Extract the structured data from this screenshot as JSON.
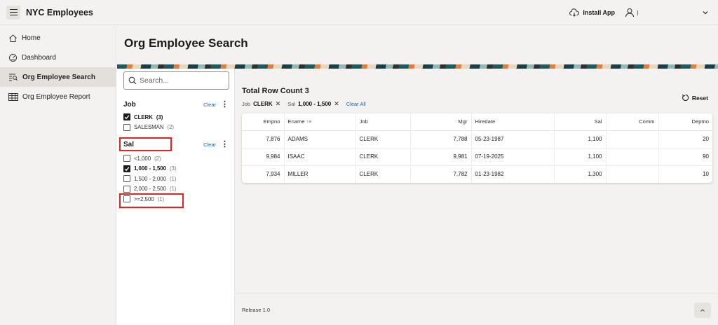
{
  "app": {
    "title": "NYC Employees"
  },
  "header": {
    "install_label": "Install App"
  },
  "sidebar": {
    "items": [
      {
        "label": "Home",
        "icon": "home-icon",
        "active": false
      },
      {
        "label": "Dashboard",
        "icon": "dashboard-icon",
        "active": false
      },
      {
        "label": "Org Employee Search",
        "icon": "search-list-icon",
        "active": true
      },
      {
        "label": "Org Employee Report",
        "icon": "table-icon",
        "active": false
      }
    ]
  },
  "page": {
    "title": "Org Employee Search"
  },
  "search": {
    "placeholder": "Search..."
  },
  "facets": {
    "job": {
      "title": "Job",
      "clear_label": "Clear",
      "options": [
        {
          "label": "CLERK",
          "count": "(3)",
          "checked": true
        },
        {
          "label": "SALESMAN",
          "count": "(2)",
          "checked": false
        }
      ]
    },
    "sal": {
      "title": "Sal",
      "clear_label": "Clear",
      "options": [
        {
          "label": "<1,000",
          "count": "(2)",
          "checked": false
        },
        {
          "label": "1,000 - 1,500",
          "count": "(3)",
          "checked": true
        },
        {
          "label": "1,500 - 2,000",
          "count": "(1)",
          "checked": false
        },
        {
          "label": "2,000 - 2,500",
          "count": "(1)",
          "checked": false
        },
        {
          "label": ">=2,500",
          "count": "(1)",
          "checked": false
        }
      ]
    }
  },
  "results": {
    "count_label": "Total Row Count 3",
    "chips": [
      {
        "facet": "Job",
        "value": "CLERK"
      },
      {
        "facet": "Sal",
        "value": "1,000 - 1,500"
      }
    ],
    "clear_all_label": "Clear All",
    "reset_label": "Reset",
    "columns": [
      "Empno",
      "Ename",
      "Job",
      "Mgr",
      "Hiredate",
      "Sal",
      "Comm",
      "Deptno"
    ],
    "rows": [
      {
        "empno": "7,876",
        "ename": "ADAMS",
        "job": "CLERK",
        "mgr": "7,788",
        "hiredate": "05-23-1987",
        "sal": "1,100",
        "comm": "",
        "deptno": "20"
      },
      {
        "empno": "9,984",
        "ename": "ISAAC",
        "job": "CLERK",
        "mgr": "9,981",
        "hiredate": "07-19-2025",
        "sal": "1,100",
        "comm": "",
        "deptno": "90"
      },
      {
        "empno": "7,934",
        "ename": "MILLER",
        "job": "CLERK",
        "mgr": "7,782",
        "hiredate": "01-23-1982",
        "sal": "1,300",
        "comm": "",
        "deptno": "10"
      }
    ]
  },
  "footer": {
    "release_label": "Release 1.0"
  },
  "colors": {
    "highlight": "#e02424",
    "link": "#1d5e9c",
    "shell": "#f4f2f0"
  }
}
